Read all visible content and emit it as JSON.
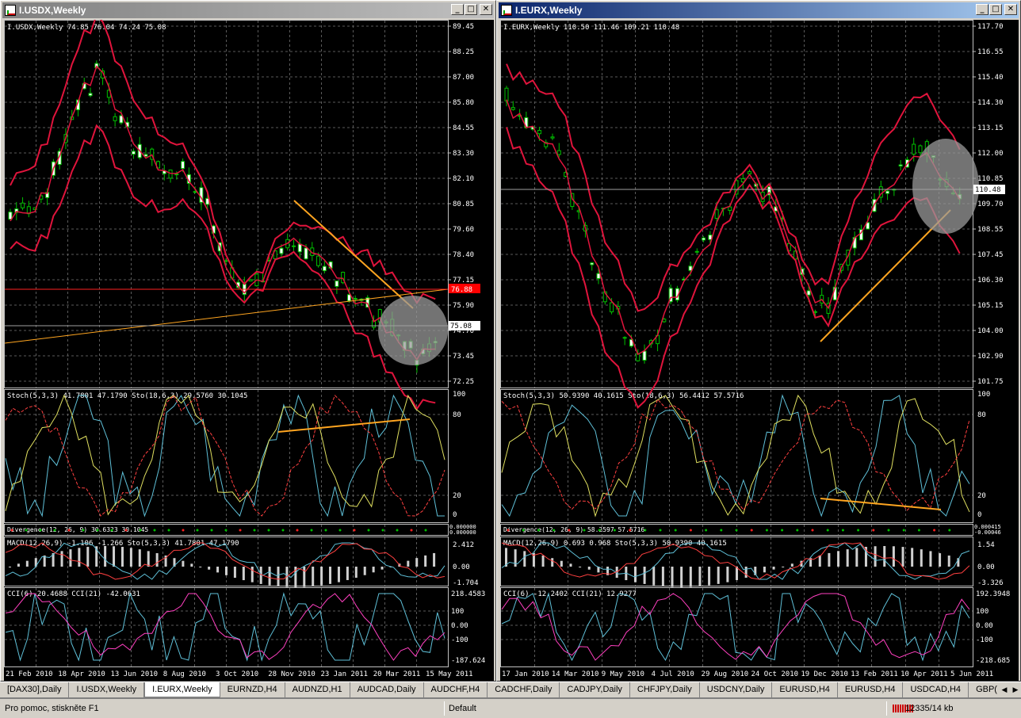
{
  "windows": [
    {
      "title": "I.USDX,Weekly",
      "legend_main": "I.USDX,Weekly  74.85 76.04 74.24 75.08",
      "y_labels": [
        "89.45",
        "88.25",
        "87.00",
        "85.80",
        "84.55",
        "83.30",
        "82.10",
        "80.85",
        "79.60",
        "78.40",
        "77.15",
        "75.90",
        "74.70",
        "73.45",
        "72.25"
      ],
      "price_tag": "75.08",
      "red_tag": "76.88",
      "stoch_legend": "Stoch(5,3,3) 41.7801 47.1790   Sto(18,6,3) 29.5760 30.1045",
      "stoch_labels": [
        "100",
        "80",
        "20",
        "0"
      ],
      "div_legend": "Divergence(12, 26, 9) 30.6323 30.1045",
      "div_labels": [
        "0.000000",
        "0.000000"
      ],
      "macd_legend": "MACD(12,26,9) -1.106 -1.266   Sto(5,3,3) 41.7801 47.1790",
      "macd_labels": [
        "2.412",
        "0.00",
        "-1.704"
      ],
      "cci_legend": "CCI(6) 20.4688   CCI(21) -42.0631",
      "cci_labels": [
        "218.4583",
        "100",
        "0.00",
        "-100",
        "-187.624"
      ],
      "x_labels": [
        "21 Feb 2010",
        "18 Apr 2010",
        "13 Jun 2010",
        "8 Aug 2010",
        "3 Oct 2010",
        "28 Nov 2010",
        "23 Jan 2011",
        "20 Mar 2011",
        "15 May 2011"
      ]
    },
    {
      "title": "I.EURX,Weekly",
      "legend_main": "I.EURX,Weekly  110.50 111.46 109.21 110.48",
      "y_labels": [
        "117.70",
        "116.55",
        "115.40",
        "114.30",
        "113.15",
        "112.00",
        "110.85",
        "109.70",
        "108.55",
        "107.45",
        "106.30",
        "105.15",
        "104.00",
        "102.90",
        "101.75"
      ],
      "price_tag": "110.48",
      "stoch_legend": "Stoch(5,3,3) 50.9390 40.1615   Sto(18,6,3) 56.4412 57.5716",
      "stoch_labels": [
        "100",
        "80",
        "20",
        "0"
      ],
      "div_legend": "Divergence(12, 26, 9) 58.2597 57.5716",
      "div_labels": [
        "0.000415",
        "-0.00046"
      ],
      "macd_legend": "MACD(12,26,9) 0.693 0.968   Sto(5,3,3) 50.9390 40.1615",
      "macd_labels": [
        "1.54",
        "0.00",
        "-3.326"
      ],
      "cci_legend": "CCI(6) -12.2402   CCI(21) 12.9277",
      "cci_labels": [
        "192.3948",
        "100",
        "0.00",
        "-100",
        "-218.685"
      ],
      "x_labels": [
        "17 Jan 2010",
        "14 Mar 2010",
        "9 May 2010",
        "4 Jul 2010",
        "29 Aug 2010",
        "24 Oct 2010",
        "19 Dec 2010",
        "13 Feb 2011",
        "10 Apr 2011",
        "5 Jun 2011"
      ]
    }
  ],
  "buttons": {
    "minimize": "_",
    "maximize": "□",
    "close": "✕"
  },
  "tabs": [
    "[DAX30],Daily",
    "I.USDX,Weekly",
    "I.EURX,Weekly",
    "EURNZD,H4",
    "AUDNZD,H1",
    "AUDCAD,Daily",
    "AUDCHF,H4",
    "CADCHF,Daily",
    "CADJPY,Daily",
    "CHFJPY,Daily",
    "USDCNY,Daily",
    "EURUSD,H4",
    "EURUSD,H4",
    "USDCAD,H4",
    "GBP("
  ],
  "active_tab": 2,
  "status": {
    "help": "Pro pomoc, stiskněte F1",
    "profile": "Default",
    "traffic": "12335/14 kb"
  },
  "colors": {
    "grid": "#5a5a5a",
    "bands": "#e0143c",
    "bull": "#ffffff",
    "bear": "#00c000",
    "stoch_main": "#5fc0d8",
    "stoch_signal": "#ff4040",
    "stoch_slow": "#e0e060",
    "trend": "#ffa520",
    "ellipse": "#9a9a9a",
    "cci_fast": "#5fc0d8",
    "cci_slow": "#ff40c0"
  }
}
